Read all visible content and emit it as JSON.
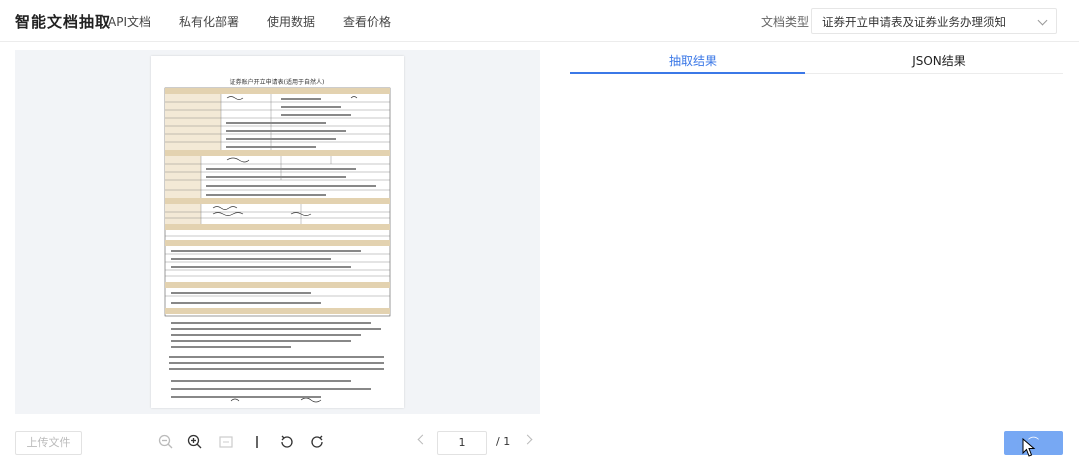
{
  "header": {
    "logo": "智能文档抽取",
    "nav": [
      "API文档",
      "私有化部署",
      "使用数据",
      "查看价格"
    ],
    "doctype_label": "文档类型",
    "doctype_value": "证券开立申请表及证券业务办理须知"
  },
  "preview": {
    "document_title": "证券账户开立申请表(适用于自然人)"
  },
  "toolbar": {
    "upload_label": "上传文件",
    "icons": [
      "zoom-out-icon",
      "zoom-in-icon",
      "fit-icon",
      "divider",
      "rotate-left-icon",
      "rotate-right-icon"
    ],
    "page_current": "1",
    "page_total": "/ 1"
  },
  "tabs": {
    "active": "抽取结果",
    "inactive": "JSON结果"
  },
  "action": {
    "extract_label": "⌒"
  },
  "colors": {
    "accent": "#3b78e7",
    "button": "#4a8bf0",
    "preview_bg": "#f2f4f7"
  }
}
